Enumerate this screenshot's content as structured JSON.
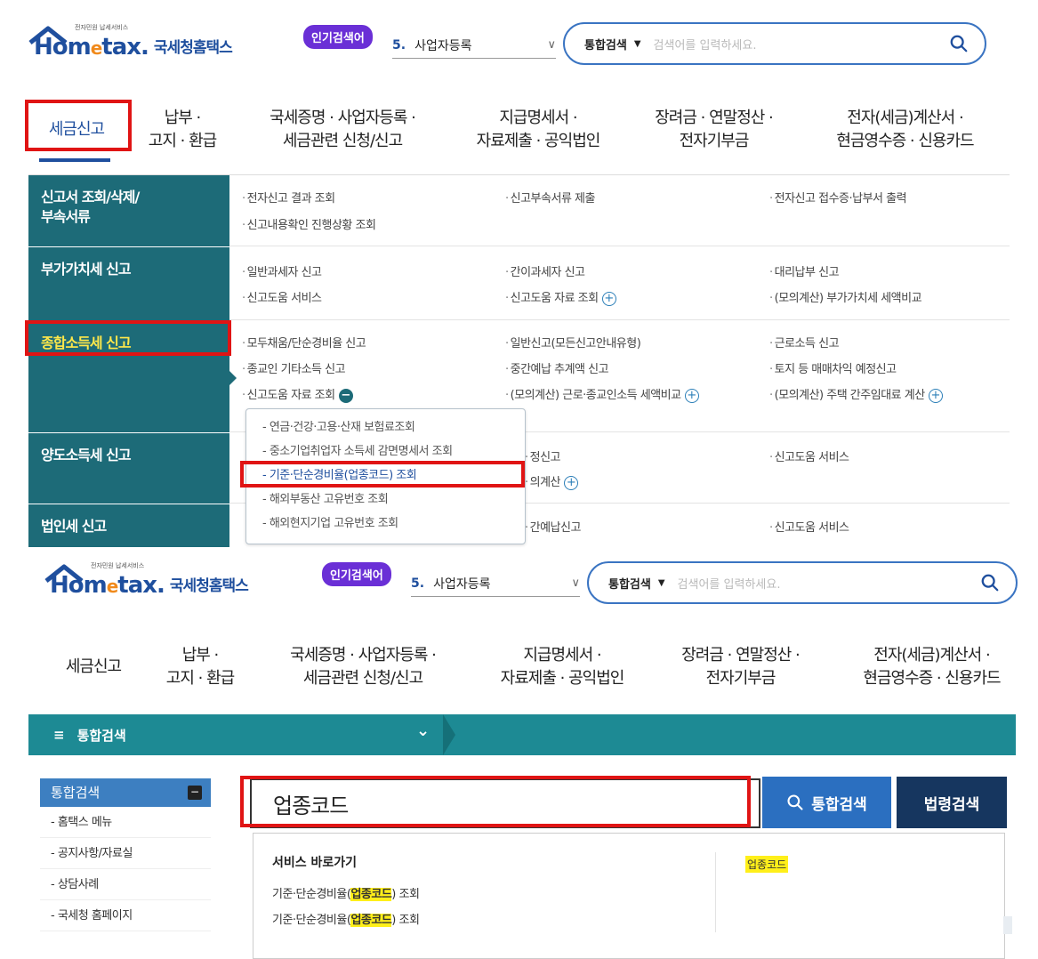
{
  "top": {
    "logo": {
      "word_home": "Hom",
      "word_e": "e",
      "word_tax": "tax.",
      "kr": "국세청홈택스",
      "tiny": "전자민원 납세서비스"
    },
    "hot_badge": "인기검색어",
    "rank": {
      "num": "5.",
      "text": "사업자등록"
    },
    "search": {
      "scope": "통합검색",
      "placeholder": "검색어를 입력하세요."
    },
    "gnb": [
      {
        "l1": "세금신고",
        "l2": ""
      },
      {
        "l1": "납부 ·",
        "l2": "고지 · 환급"
      },
      {
        "l1": "국세증명 · 사업자등록 ·",
        "l2": "세금관련 신청/신고"
      },
      {
        "l1": "지급명세서 ·",
        "l2": "자료제출 · 공익법인"
      },
      {
        "l1": "장려금 · 연말정산 ·",
        "l2": "전자기부금"
      },
      {
        "l1": "전자(세금)계산서 ·",
        "l2": "현금영수증 · 신용카드"
      }
    ],
    "menu": {
      "row1": {
        "head": "신고서 조회/삭제/\n부속서류",
        "c1a": "전자신고 결과 조회",
        "c1b": "신고내용확인 진행상황 조회",
        "c2a": "신고부속서류 제출",
        "c3a": "전자신고 접수증·납부서 출력"
      },
      "row2": {
        "head": "부가가치세 신고",
        "c1a": "일반과세자 신고",
        "c1b": "신고도움 서비스",
        "c2a": "간이과세자 신고",
        "c2b": "신고도움 자료 조회",
        "c3a": "대리납부 신고",
        "c3b": "(모의계산) 부가가치세 세액비교"
      },
      "row3": {
        "head": "종합소득세 신고",
        "c1a": "모두채움/단순경비율 신고",
        "c1b": "종교인 기타소득 신고",
        "c1c": "신고도움 자료 조회",
        "c2a": "일반신고(모든신고안내유형)",
        "c2b": "중간예납 추계액 신고",
        "c2c": "(모의계산) 근로·종교인소득 세액비교",
        "c3a": "근로소득 신고",
        "c3b": "토지 등 매매차익 예정신고",
        "c3c": "(모의계산) 주택 간주임대료 계산"
      },
      "row4": {
        "head": "양도소득세 신고",
        "c2a": "정신고",
        "c2b": "의계산",
        "c3a": "신고도움 서비스"
      },
      "row5": {
        "head": "법인세 신고",
        "c2a": "간예납신고",
        "c3a": "신고도움 서비스"
      },
      "submenu": [
        "연금·건강·고용·산재 보험료조회",
        "중소기업취업자 소득세 감면명세서 조회",
        "기준·단순경비율(업종코드) 조회",
        "해외부동산 고유번호 조회",
        "해외현지기업 고유번호 조회"
      ]
    }
  },
  "bottom": {
    "logo": {
      "word_home": "Hom",
      "word_e": "e",
      "word_tax": "tax.",
      "kr": "국세청홈택스",
      "tiny": "전자민원 납세서비스"
    },
    "hot_badge": "인기검색어",
    "rank": {
      "num": "5.",
      "text": "사업자등록"
    },
    "search": {
      "scope": "통합검색",
      "placeholder": "검색어를 입력하세요."
    },
    "gnb": [
      {
        "l1": "세금신고",
        "l2": ""
      },
      {
        "l1": "납부 ·",
        "l2": "고지 · 환급"
      },
      {
        "l1": "국세증명 · 사업자등록 ·",
        "l2": "세금관련 신청/신고"
      },
      {
        "l1": "지급명세서 ·",
        "l2": "자료제출 · 공익법인"
      },
      {
        "l1": "장려금 · 연말정산 ·",
        "l2": "전자기부금"
      },
      {
        "l1": "전자(세금)계산서 ·",
        "l2": "현금영수증 · 신용카드"
      }
    ],
    "teal_bar": {
      "icon": "≡",
      "label": "통합검색",
      "chev": "⌄"
    },
    "left_panel": {
      "head": "통합검색",
      "items": [
        "홈택스 메뉴",
        "공지사항/자료실",
        "상담사례",
        "국세청 홈페이지"
      ]
    },
    "query": "업종코드",
    "btn_total": "통합검색",
    "btn_law": "법령검색",
    "results": {
      "title": "서비스 바로가기",
      "link_pre": "기준·단순경비율(",
      "link_hl": "업종코드",
      "link_post": ") 조회",
      "keyword": "업종코드"
    }
  },
  "colors": {
    "accent_red": "#e01414",
    "teal": "#1d6b78",
    "navy": "#1f4f9e",
    "highlight": "#ffef1a"
  }
}
